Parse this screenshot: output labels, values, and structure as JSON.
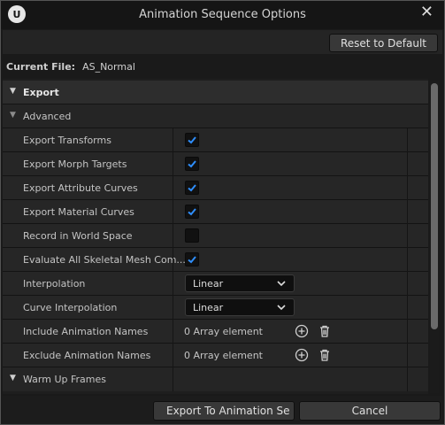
{
  "window": {
    "title": "Animation Sequence Options",
    "logo_text": "U",
    "close_glyph": "✕"
  },
  "toolbar": {
    "reset_label": "Reset to Default"
  },
  "current_file": {
    "label": "Current File:",
    "value": "AS_Normal"
  },
  "sections": {
    "export": "Export",
    "advanced": "Advanced",
    "warmup": "Warm Up Frames"
  },
  "properties": {
    "export_transforms": {
      "label": "Export Transforms",
      "checked": true
    },
    "export_morph_targets": {
      "label": "Export Morph Targets",
      "checked": true
    },
    "export_attribute_curves": {
      "label": "Export Attribute Curves",
      "checked": true
    },
    "export_material_curves": {
      "label": "Export Material Curves",
      "checked": true
    },
    "record_in_world_space": {
      "label": "Record in World Space",
      "checked": false
    },
    "evaluate_all_skeletal": {
      "label": "Evaluate All Skeletal Mesh Com...",
      "checked": true
    },
    "interpolation": {
      "label": "Interpolation",
      "value": "Linear"
    },
    "curve_interpolation": {
      "label": "Curve Interpolation",
      "value": "Linear"
    },
    "include_animation_names": {
      "label": "Include Animation Names",
      "value": "0 Array element"
    },
    "exclude_animation_names": {
      "label": "Exclude Animation Names",
      "value": "0 Array element"
    }
  },
  "footer": {
    "export_label": "Export To Animation Se",
    "cancel_label": "Cancel"
  },
  "colors": {
    "check_accent": "#2f8fff",
    "background": "#1a1a1a",
    "header_row": "#2d2d2d"
  },
  "icons": {
    "logo": "unreal-logo-icon",
    "close": "close-icon",
    "add": "add-element-icon",
    "delete": "trash-icon",
    "expand": "triangle-down-icon",
    "chevron": "chevron-down-icon",
    "check": "checkmark-icon"
  }
}
